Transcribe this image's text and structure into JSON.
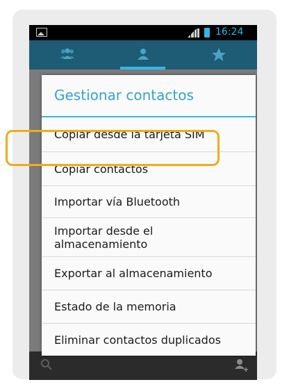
{
  "status_bar": {
    "time": "16:24",
    "accent_color": "#33b5e5"
  },
  "tabs": [
    {
      "icon": "group-icon",
      "active": false
    },
    {
      "icon": "person-icon",
      "active": true
    },
    {
      "icon": "star-icon",
      "active": false
    }
  ],
  "dialog": {
    "title": "Gestionar contactos",
    "items": [
      {
        "label": "Copiar desde la tarjeta SIM"
      },
      {
        "label": "Copiar contactos",
        "highlighted": true
      },
      {
        "label": "Importar vía Bluetooth"
      },
      {
        "label": "Importar desde el almacenamiento"
      },
      {
        "label": "Exportar al almacenamiento"
      },
      {
        "label": "Estado de la memoria"
      },
      {
        "label": "Eliminar contactos duplicados"
      }
    ]
  },
  "colors": {
    "highlight": "#f2aa1a",
    "tab_bar": "#1d5c74",
    "title": "#33a3cf"
  },
  "bottom_bar": {
    "icons": [
      "search-icon",
      "add-contact-icon"
    ]
  }
}
